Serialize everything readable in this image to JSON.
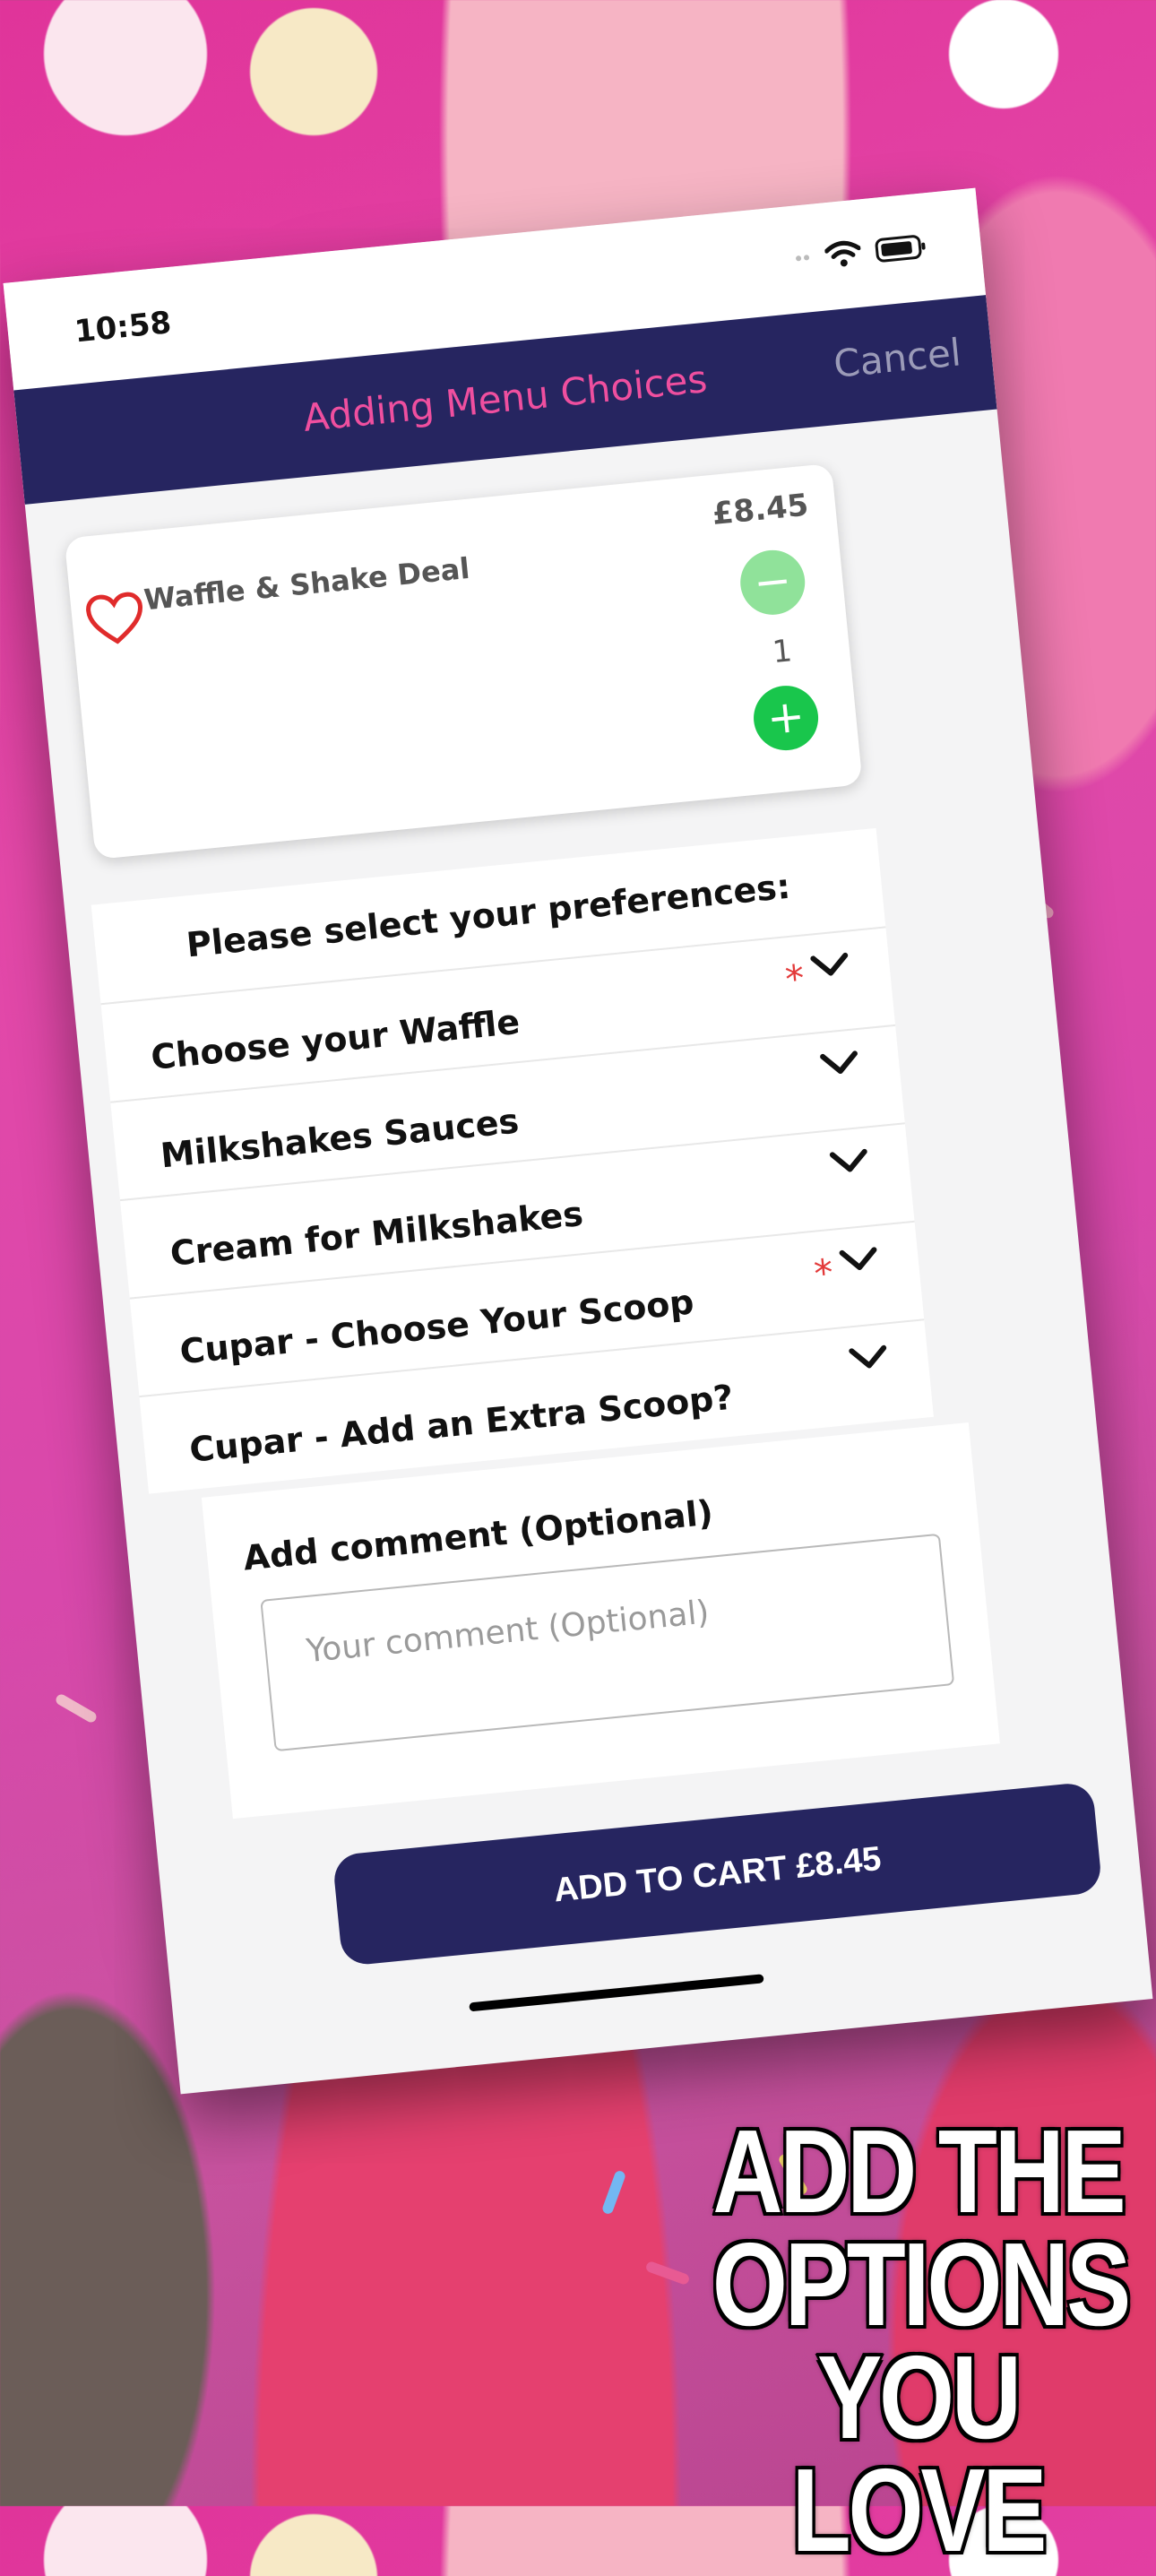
{
  "status_bar": {
    "time": "10:58"
  },
  "nav": {
    "title": "Adding Menu Choices",
    "cancel_label": "Cancel"
  },
  "product": {
    "name": "Waffle & Shake Deal",
    "price": "£8.45",
    "quantity": "1",
    "minus_label": "−",
    "plus_label": "+"
  },
  "preferences": {
    "header": "Please select your preferences:",
    "options": [
      {
        "label": "Choose your Waffle",
        "required_mark": "*"
      },
      {
        "label": "Milkshakes Sauces",
        "required_mark": ""
      },
      {
        "label": "Cream for Milkshakes",
        "required_mark": ""
      },
      {
        "label": "Cupar - Choose Your Scoop",
        "required_mark": "*"
      },
      {
        "label": "Cupar - Add an Extra Scoop?",
        "required_mark": ""
      }
    ]
  },
  "comment": {
    "label": "Add comment (Optional)",
    "placeholder": "Your comment (Optional)"
  },
  "cart": {
    "button_label": "ADD TO CART £8.45"
  },
  "promo": {
    "line1": "ADD THE",
    "line2": "OPTIONS",
    "line3": "YOU LOVE"
  },
  "colors": {
    "nav_background": "#262560",
    "nav_title": "#ef4f9f",
    "plus_button": "#19c64c",
    "minus_button": "#90e29a",
    "required_mark": "#e33a3a"
  }
}
